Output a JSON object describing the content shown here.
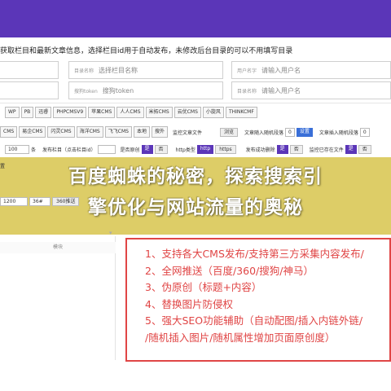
{
  "header": {
    "info_text": "获取栏目和最新文章信息，选择栏目id用于自动发布，未修改后台目录的可以不用填写目录"
  },
  "fields": {
    "column_label": "目录名称",
    "column_placeholder": "选择栏目名称",
    "user_label": "用户名字",
    "user_placeholder": "请输入用户名",
    "token_label": "搜狗token",
    "token_placeholder": "搜狗token",
    "dir_label": "目录名称",
    "dir_placeholder": "请输入用户名"
  },
  "cms_row": [
    "WP",
    "PB",
    "迅睿",
    "PHPCMSV9",
    "苹果CMS",
    "人人CMS",
    "米拓CMS",
    "云优CMS",
    "小旋风",
    "THINKCMF"
  ],
  "cms_row2": [
    "CMS",
    "易企CMS",
    "闪灵CMS",
    "海洋CMS",
    "飞飞CMS",
    "本地",
    "搜外"
  ],
  "row2_extras": {
    "keyword_position_label": "监控文章文件",
    "browse_btn": "浏览",
    "insert_label": "文章随入随机段落",
    "insert_value": "0",
    "set_btn": "设置",
    "insert2_label": "文章插入随机段落",
    "insert2_value": "0"
  },
  "row3": {
    "count_value": "100",
    "batch_label": "条",
    "publish_label": "发布栏目（点击栏目id）",
    "original_label": "是否原创",
    "yes1": "是",
    "no1": "否",
    "http_label": "http类型",
    "http": "http",
    "https": "https",
    "delete_label": "发布成功删除",
    "yes2": "是",
    "no2": "否",
    "monitor_label": "监控已存在文件",
    "yes3": "是",
    "no3": "否"
  },
  "row4": {
    "a": "置",
    "b": "1200",
    "c": "36#",
    "d": "360推送"
  },
  "headline": {
    "line1": "百度蜘蛛的秘密，探索搜索引",
    "line2": "擎优化与网站流量的奥秘"
  },
  "left_panel": {
    "header": "模块"
  },
  "features": [
    "1、支持各大CMS发布/支持第三方采集内容发布/",
    "2、全网推送（百度/360/搜狗/神马）",
    "3、伪原创（标题+内容）",
    "4、替换图片防侵权",
    "5、强大SEO功能辅助（自动配图/插入内链外链/",
    "/随机插入图片/随机属性增加页面原创度）"
  ],
  "colors": {
    "accent": "#5b36b8",
    "feature_red": "#e04545",
    "banner": "#d6c246"
  }
}
